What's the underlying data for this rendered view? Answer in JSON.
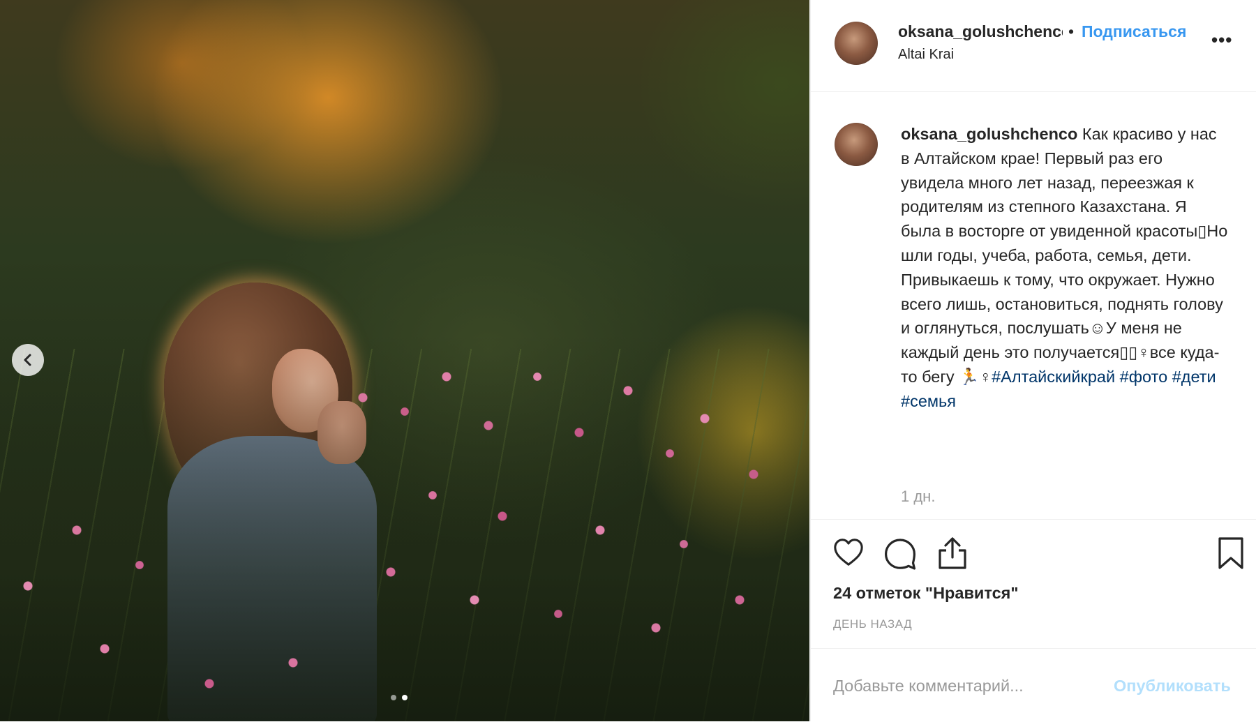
{
  "post": {
    "username": "oksana_golushchenco",
    "follow_label": "Подписаться",
    "separator": "•",
    "location": "Altai Krai",
    "more_label": "•••"
  },
  "caption": {
    "username": "oksana_golushchenco",
    "text": " Как красиво у нас в Алтайском крае! Первый раз его увидела много лет назад, переезжая к родителям из степного Казахстана. Я была в восторге от увиденной красоты▯Но шли годы, учеба, работа, семья, дети. Привыкаешь к тому, что окружает. Нужно всего лишь, остановиться, поднять голову и оглянуться, послушать☺У меня не каждый день это получается▯▯♀все куда-то бегу 🏃♀",
    "hashtags": [
      "#Алтайскийкрай",
      "#фото",
      "#дети",
      "#семья"
    ],
    "time_ago": "1 дн."
  },
  "actions": {
    "likes": "24 отметок \"Нравится\"",
    "date": "ДЕНЬ НАЗАД"
  },
  "comment": {
    "placeholder": "Добавьте комментарий...",
    "publish_label": "Опубликовать"
  },
  "carousel": {
    "total": 2,
    "current": 2
  },
  "colors": {
    "accent": "#3897f0",
    "hashtag": "#003569",
    "muted": "#999999",
    "publish_disabled": "#b2dffc"
  }
}
